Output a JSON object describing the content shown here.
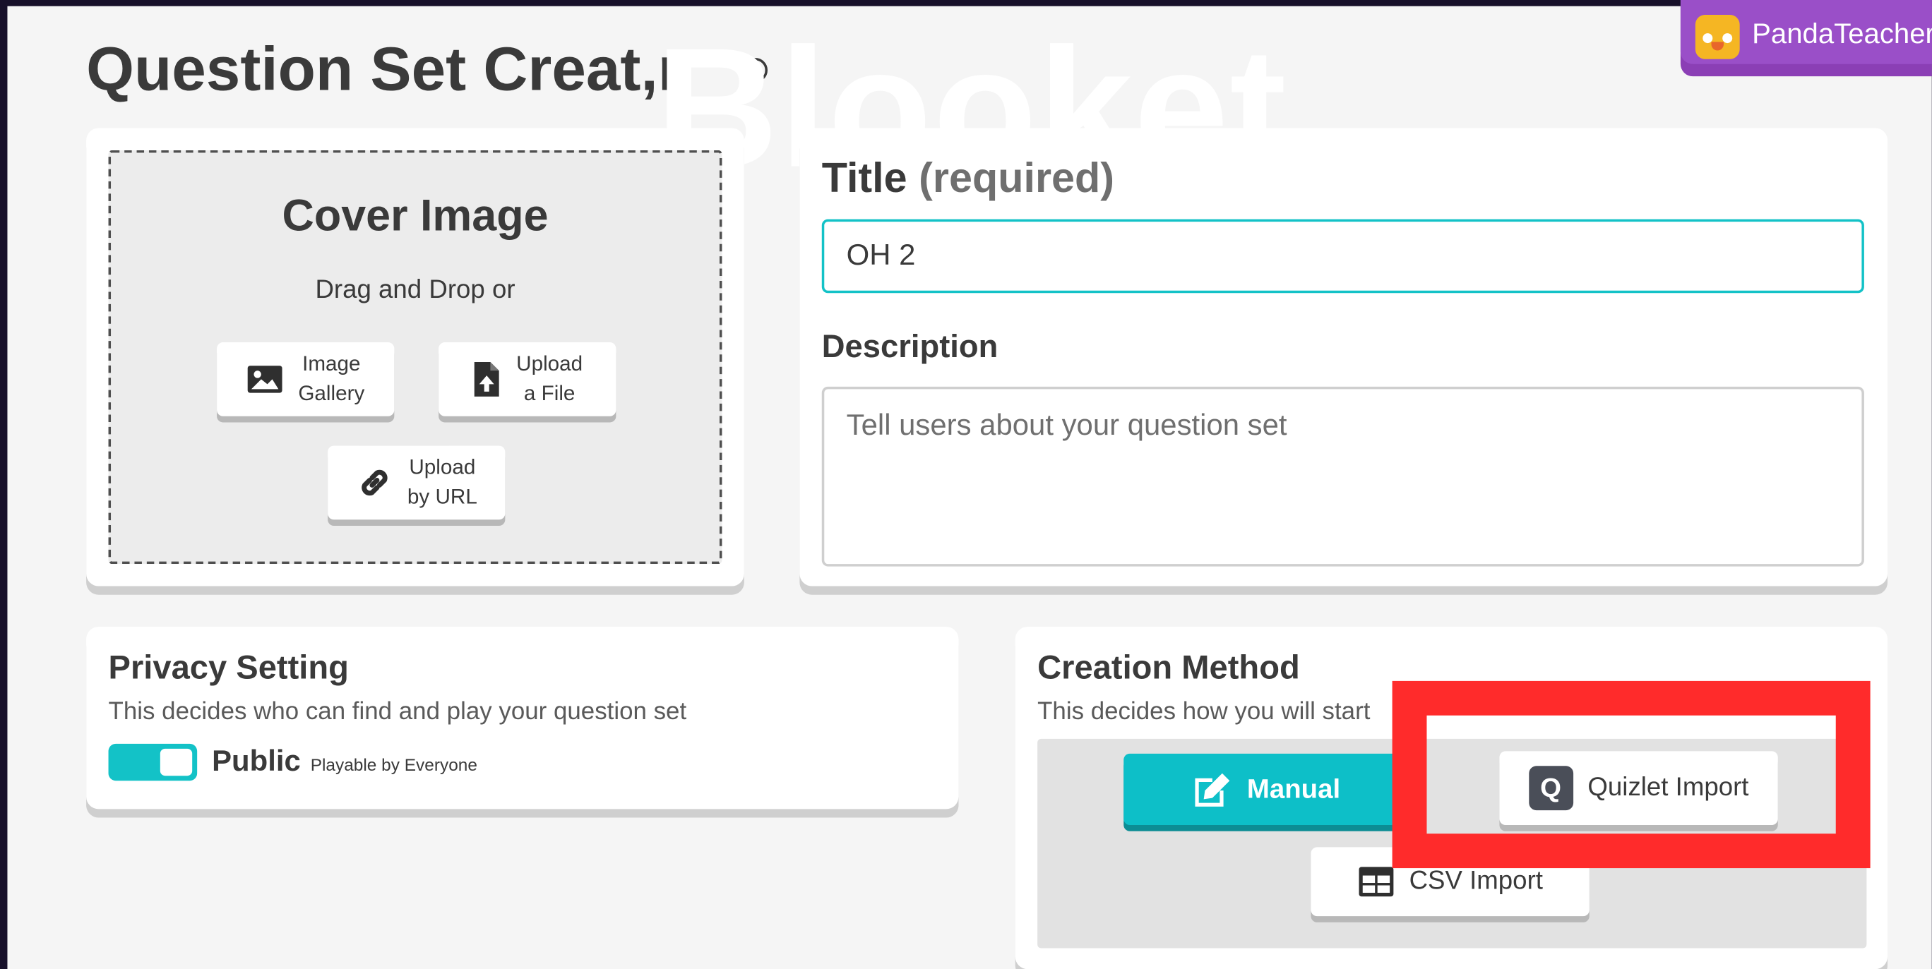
{
  "brand": {
    "logo_text": "Blooket"
  },
  "header": {
    "title": "Question Set Creat",
    "title_fragment": ",r",
    "help_icon": "question-circle-icon"
  },
  "user": {
    "name": "PandaTeacher",
    "avatar_icon": "bird-avatar-icon"
  },
  "cover": {
    "title": "Cover Image",
    "subtitle": "Drag and Drop or",
    "buttons": [
      {
        "label": "Image\nGallery",
        "icon": "image-icon"
      },
      {
        "label": "Upload\na File",
        "icon": "file-upload-icon"
      },
      {
        "label": "Upload\nby URL",
        "icon": "link-icon"
      }
    ]
  },
  "title_field": {
    "label": "Title",
    "required": "(required)",
    "value": "OH 2"
  },
  "description_field": {
    "label": "Description",
    "placeholder": "Tell users about your question set",
    "value": ""
  },
  "privacy": {
    "title": "Privacy Setting",
    "subtitle": "This decides who can find and play your question set",
    "toggle_on": true,
    "label": "Public",
    "description": "Playable by Everyone"
  },
  "creation_method": {
    "title": "Creation Method",
    "subtitle": "This decides how you will start",
    "buttons": {
      "manual": "Manual",
      "quizlet": "Quizlet Import",
      "csv": "CSV Import"
    }
  },
  "colors": {
    "accent": "#13c2c7",
    "user_badge": "#9a4fc8",
    "highlight": "#ff2b2b",
    "background": "#17102a"
  }
}
